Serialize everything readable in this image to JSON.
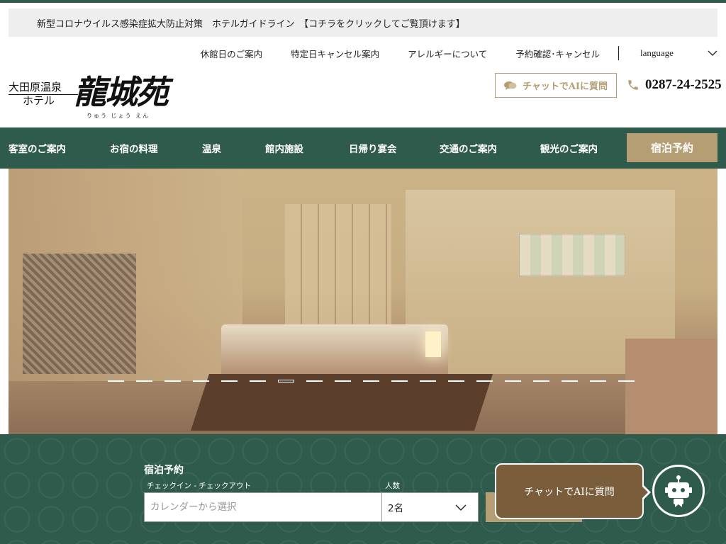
{
  "notice": {
    "text": "新型コロナウイルス感染症拡大防止対策　ホテルガイドライン　【コチラをクリックしてご覧頂けます】"
  },
  "utility_nav": {
    "items": [
      "休館日のご案内",
      "特定日キャンセル案内",
      "アレルギーについて",
      "予約確認･キャンセル"
    ],
    "language_label": "language"
  },
  "logo": {
    "sub_line1": "大田原温泉",
    "sub_line2": "ホテル",
    "main": "龍城苑",
    "kana": "りゅう じょう えん"
  },
  "header": {
    "chat_label": "チャットでAIに質問",
    "phone": "0287-24-2525"
  },
  "main_nav": {
    "items": [
      "客室のご案内",
      "お宿の料理",
      "温泉",
      "館内施設",
      "日帰り宴会",
      "交通のご案内",
      "観光のご案内"
    ],
    "reserve_label": "宿泊予約"
  },
  "hero": {
    "slide_count": 19,
    "active_slide": 7
  },
  "booking": {
    "title": "宿泊予約",
    "date_label": "チェックイン - チェックアウト",
    "date_placeholder": "カレンダーから選択",
    "people_label": "人数",
    "people_value": "2名"
  },
  "chat_widget": {
    "bubble_text": "チャットでAIに質問"
  },
  "colors": {
    "brand_green": "#2f5b4d",
    "accent_gold": "#b59e73",
    "bubble_brown": "#7a5d3a"
  }
}
